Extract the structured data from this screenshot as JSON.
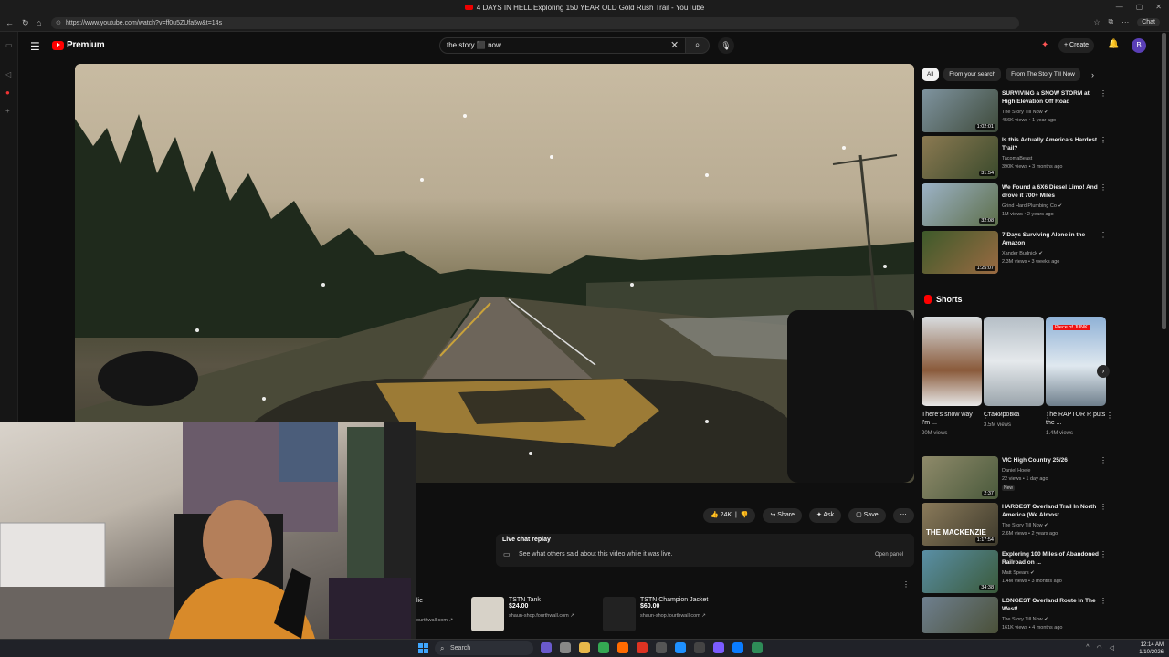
{
  "browser": {
    "tab_title": "4 DAYS IN HELL Exploring 150 YEAR OLD Gold Rush Trail - YouTube",
    "url": "https://www.youtube.com/watch?v=ff0u5ZUfa5w&t=14s",
    "chat_label": "Chat"
  },
  "header": {
    "logo_text": "Premium",
    "search_value": "the story ⬛ now",
    "create_label": "Create",
    "avatar_letter": "B"
  },
  "actions": {
    "like_count": "24K",
    "share_label": "Share",
    "ask_label": "Ask",
    "save_label": "Save"
  },
  "live_chat": {
    "title": "Live chat replay",
    "description": "See what others said about this video while it was live.",
    "open_panel": "Open panel"
  },
  "merch": [
    {
      "title": "TSTN Tank",
      "price": "$24.00",
      "link": "shaun-shop.fourthwall.com ↗"
    },
    {
      "title": "TSTN Champion Jacket",
      "price": "$60.00",
      "link": "shaun-shop.fourthwall.com ↗"
    }
  ],
  "merch_partial": {
    "title": "lie",
    "link": "ourthwall.com ↗"
  },
  "chips": [
    "All",
    "From your search",
    "From The Story Till Now"
  ],
  "recommendations": [
    {
      "title": "SURVIVING a SNOW STORM at High Elevation Off Road",
      "channel": "The Story Till Now ✔",
      "meta": "456K views • 1 year ago",
      "duration": "1:02:01",
      "thumb_color": "#5b6f78"
    },
    {
      "title": "Is this Actually America's Hardest Trail?",
      "channel": "TacomaBeast",
      "meta": "390K views • 3 months ago",
      "duration": "31:54",
      "thumb_color": "#6b5a3a"
    },
    {
      "title": "We Found a 6X6 Diesel Limo! And drove it 700+ Miles",
      "channel": "Grind Hard Plumbing Co ✔",
      "meta": "1M views • 2 years ago",
      "duration": "32:08",
      "thumb_color": "#7a8ca0"
    },
    {
      "title": "7 Days Surviving Alone in the Amazon",
      "channel": "Xander Budnick ✔",
      "meta": "2.3M views • 3 weeks ago",
      "duration": "1:25:07",
      "thumb_color": "#6e4a30"
    }
  ],
  "shorts": {
    "heading": "Shorts",
    "items": [
      {
        "title": "There's snow way I'm ...",
        "views": "20M views",
        "color": "#8a7a6a"
      },
      {
        "title": "Стажировка",
        "views": "3.5M views",
        "color": "#cfd6dc"
      },
      {
        "title": "The RAPTOR R puts the ...",
        "views": "1.4M views",
        "color": "#9fb3c8",
        "tag": "Piece of JUNK"
      }
    ]
  },
  "recommendations_2": [
    {
      "title": "VIC High Country 25/26",
      "channel": "Daniel Hoele",
      "meta": "22 views • 1 day ago",
      "duration": "2:37",
      "badge": "New",
      "thumb_color": "#7d7860"
    },
    {
      "title": "HARDEST Overland Trail In North America (We Almost ...",
      "channel": "The Story Till Now ✔",
      "meta": "2.6M views • 2 years ago",
      "duration": "1:17:54",
      "thumb_color": "#6a5d45",
      "overlay": "THE MACKENZIE"
    },
    {
      "title": "Exploring 100 Miles of Abandoned Railroad on ...",
      "channel": "Matt Spears ✔",
      "meta": "1.4M views • 3 months ago",
      "duration": "34:38",
      "thumb_color": "#4e7d8f"
    },
    {
      "title": "LONGEST Overland Route In The West!",
      "channel": "The Story Till Now ✔",
      "meta": "161K views • 4 months ago",
      "duration": "",
      "thumb_color": "#5c6a78"
    }
  ],
  "taskbar": {
    "search_label": "Search",
    "time": "12:14 AM",
    "date": "1/10/2026"
  },
  "colors": {
    "accent": "#ff0000",
    "background": "#0f0f0f",
    "chip_active": "#f1f1f1"
  }
}
